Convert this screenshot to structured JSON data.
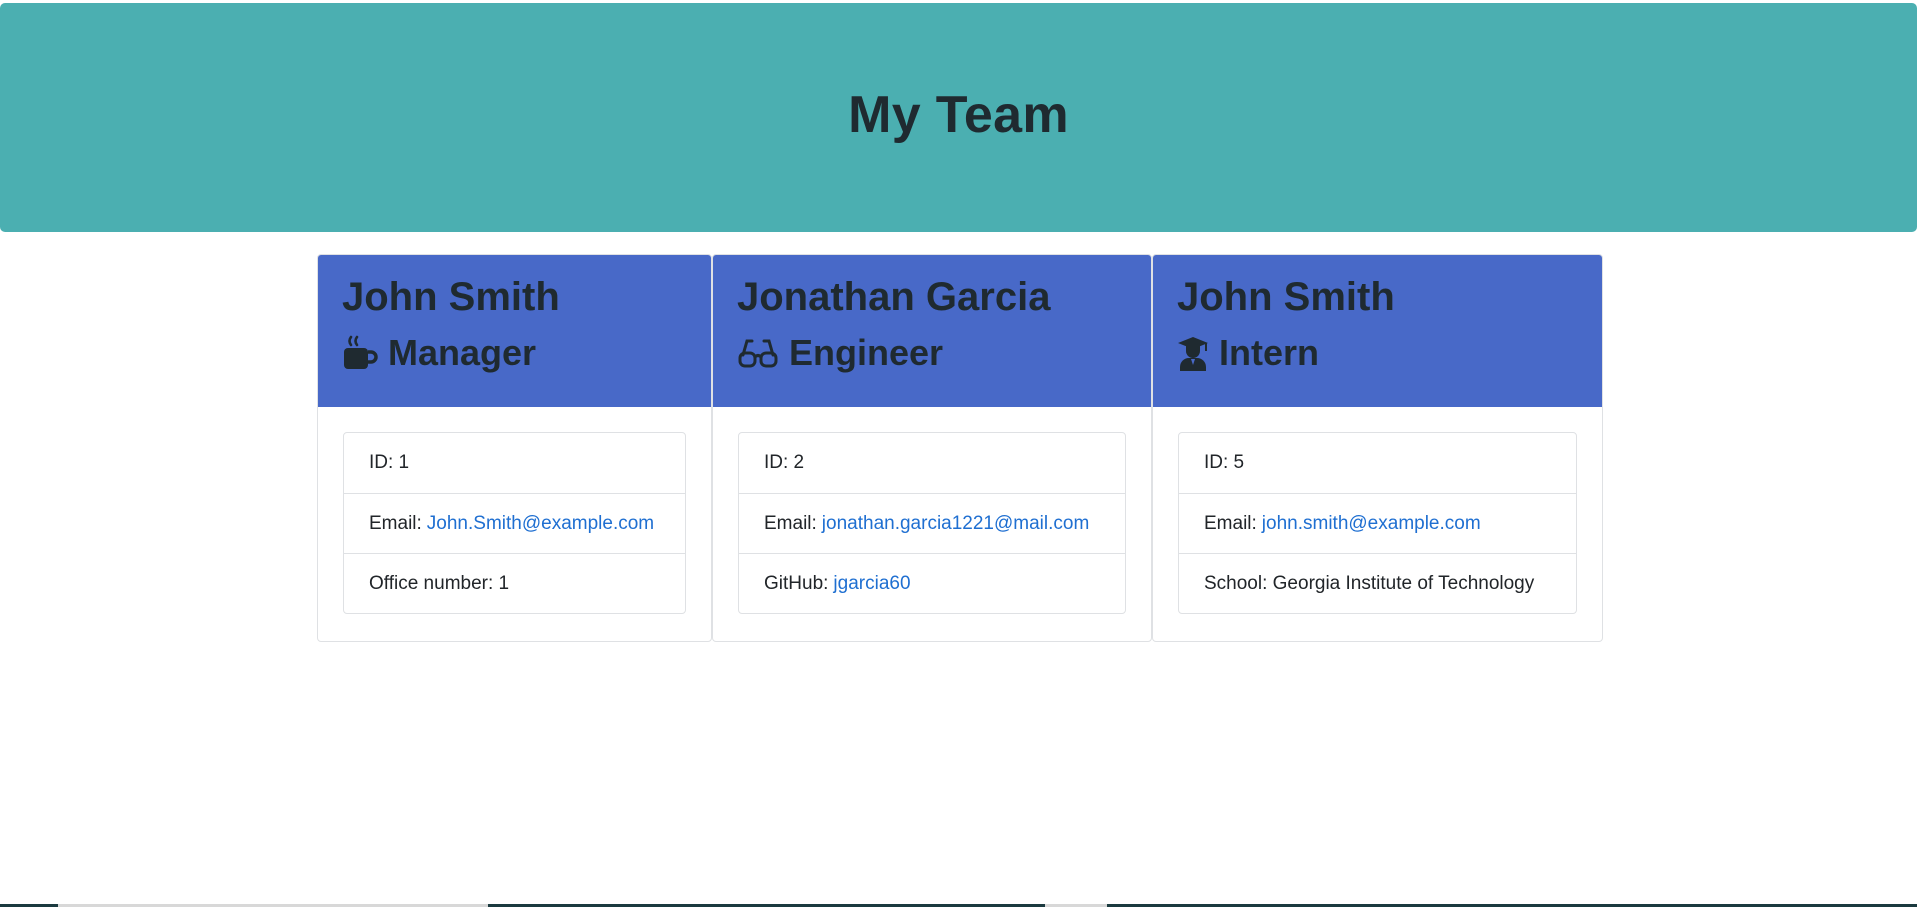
{
  "header": {
    "title": "My Team"
  },
  "cards": [
    {
      "name": "John Smith",
      "role": "Manager",
      "role_icon": "coffee-mug-icon",
      "id_label": "ID: 1",
      "email_label": "Email:",
      "email": "John.Smith@example.com",
      "extra_label": "Office number: 1",
      "extra_link": ""
    },
    {
      "name": "Jonathan Garcia",
      "role": "Engineer",
      "role_icon": "glasses-icon",
      "id_label": "ID: 2",
      "email_label": "Email:",
      "email": "jonathan.garcia1221@mail.com",
      "extra_label": "GitHub:",
      "extra_link": "jgarcia60"
    },
    {
      "name": "John Smith",
      "role": "Intern",
      "role_icon": "graduate-icon",
      "id_label": "ID: 5",
      "email_label": "Email:",
      "email": "john.smith@example.com",
      "extra_label": "School: Georgia Institute of Technology",
      "extra_link": ""
    }
  ],
  "colors": {
    "header_bg": "#4bafb1",
    "card_header_bg": "#4869c8",
    "link": "#1f6fd1",
    "text": "#212529"
  }
}
